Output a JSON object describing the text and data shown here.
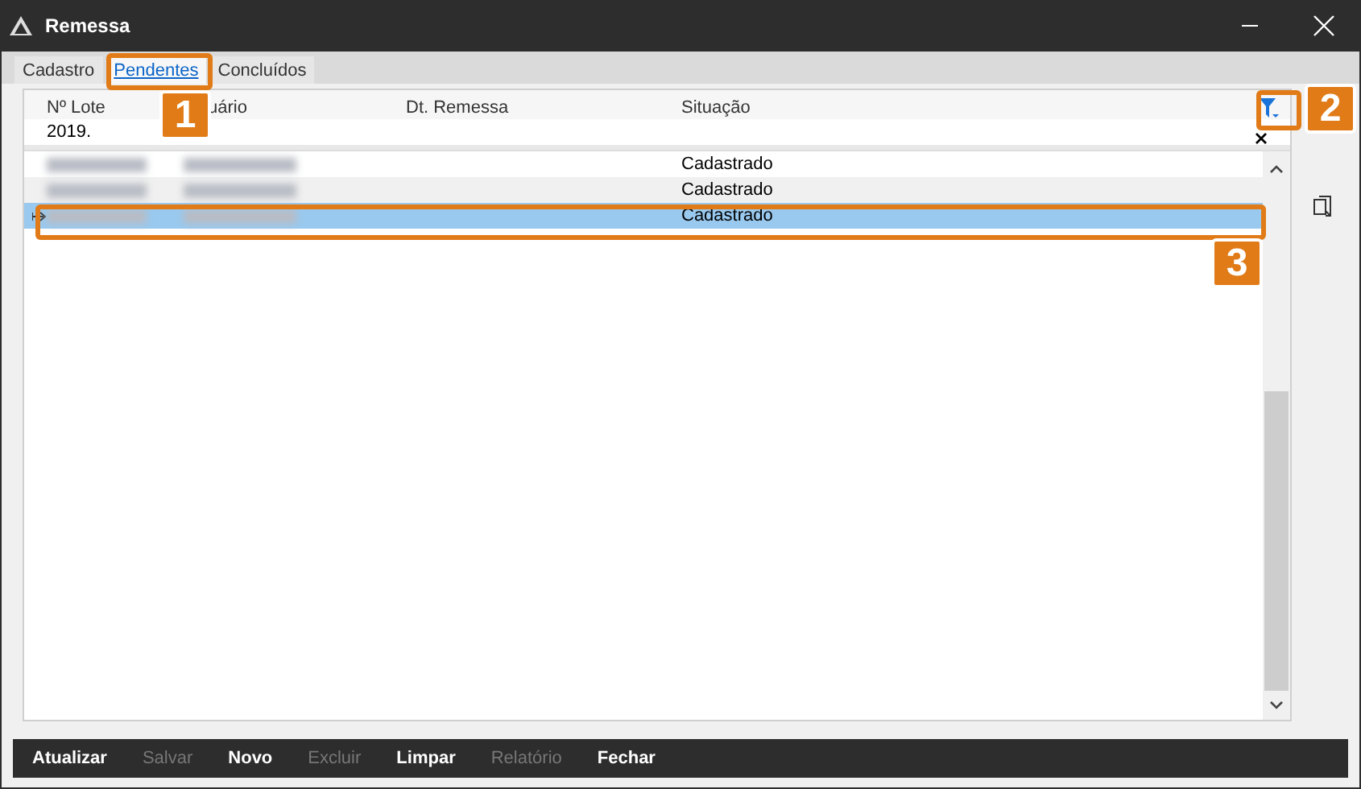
{
  "window": {
    "title": "Remessa"
  },
  "tabs": [
    {
      "label": "Cadastro",
      "selected": false
    },
    {
      "label": "Pendentes",
      "selected": true
    },
    {
      "label": "Concluídos",
      "selected": false
    }
  ],
  "table": {
    "columns": [
      "Nº Lote",
      "uário",
      "Dt. Remessa",
      "Situação"
    ],
    "filter_value": "2019.",
    "rows": [
      {
        "status": "Cadastrado",
        "redacted": true,
        "selected": false
      },
      {
        "status": "Cadastrado",
        "redacted": true,
        "selected": false
      },
      {
        "status": "Cadastrado",
        "redacted": true,
        "selected": true
      }
    ]
  },
  "toolbar": [
    {
      "label": "Atualizar",
      "disabled": false
    },
    {
      "label": "Salvar",
      "disabled": true
    },
    {
      "label": "Novo",
      "disabled": false
    },
    {
      "label": "Excluir",
      "disabled": true
    },
    {
      "label": "Limpar",
      "disabled": false
    },
    {
      "label": "Relatório",
      "disabled": true
    },
    {
      "label": "Fechar",
      "disabled": false
    }
  ],
  "callouts": [
    {
      "label": "1"
    },
    {
      "label": "2"
    },
    {
      "label": "3"
    }
  ]
}
